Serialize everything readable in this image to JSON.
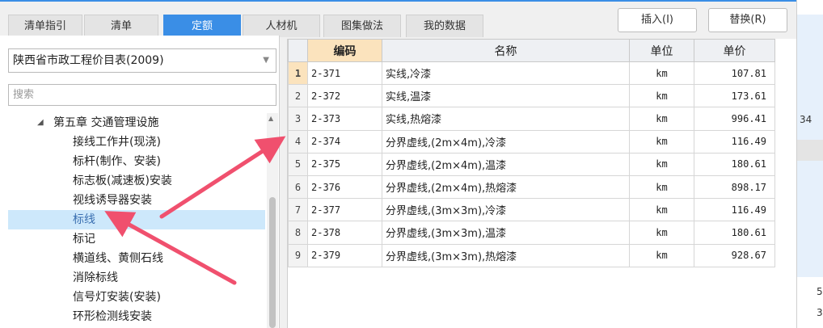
{
  "tabs": [
    {
      "label": "清单指引"
    },
    {
      "label": "清单"
    },
    {
      "label": "定额"
    },
    {
      "label": "人材机"
    },
    {
      "label": "图集做法"
    },
    {
      "label": "我的数据"
    }
  ],
  "active_tab": "定额",
  "toolbar": {
    "insert_label": "插入(I)",
    "replace_label": "替换(R)"
  },
  "library_select": {
    "value": "陕西省市政工程价目表(2009)"
  },
  "search": {
    "placeholder": "搜索"
  },
  "tree": {
    "chapter": "第五章 交通管理设施",
    "items": [
      {
        "label": "接线工作井(现浇)"
      },
      {
        "label": "标杆(制作、安装)"
      },
      {
        "label": "标志板(减速板)安装"
      },
      {
        "label": "视线诱导器安装"
      },
      {
        "label": "标线",
        "selected": true
      },
      {
        "label": "标记"
      },
      {
        "label": "横道线、黄侧石线"
      },
      {
        "label": "消除标线"
      },
      {
        "label": "信号灯安装(安装)"
      },
      {
        "label": "环形检测线安装"
      }
    ]
  },
  "grid": {
    "headers": {
      "code": "编码",
      "name": "名称",
      "unit": "单位",
      "price": "单价"
    },
    "rows": [
      {
        "n": "1",
        "code": "2-371",
        "name": "实线,冷漆",
        "unit": "km",
        "price": "107.81"
      },
      {
        "n": "2",
        "code": "2-372",
        "name": "实线,温漆",
        "unit": "km",
        "price": "173.61"
      },
      {
        "n": "3",
        "code": "2-373",
        "name": "实线,热熔漆",
        "unit": "km",
        "price": "996.41"
      },
      {
        "n": "4",
        "code": "2-374",
        "name": "分界虚线,(2m×4m),冷漆",
        "unit": "km",
        "price": "116.49"
      },
      {
        "n": "5",
        "code": "2-375",
        "name": "分界虚线,(2m×4m),温漆",
        "unit": "km",
        "price": "180.61"
      },
      {
        "n": "6",
        "code": "2-376",
        "name": "分界虚线,(2m×4m),热熔漆",
        "unit": "km",
        "price": "898.17"
      },
      {
        "n": "7",
        "code": "2-377",
        "name": "分界虚线,(3m×3m),冷漆",
        "unit": "km",
        "price": "116.49"
      },
      {
        "n": "8",
        "code": "2-378",
        "name": "分界虚线,(3m×3m),温漆",
        "unit": "km",
        "price": "180.61"
      },
      {
        "n": "9",
        "code": "2-379",
        "name": "分界虚线,(3m×3m),热熔漆",
        "unit": "km",
        "price": "928.67"
      }
    ]
  },
  "right_edge": {
    "t1": "34",
    "t2": "5",
    "t3": "3"
  },
  "colors": {
    "accent": "#3a8ee6",
    "selected_row": "#cde8fb",
    "header_highlight": "#fbe3bd",
    "arrow": "#f0506e"
  }
}
